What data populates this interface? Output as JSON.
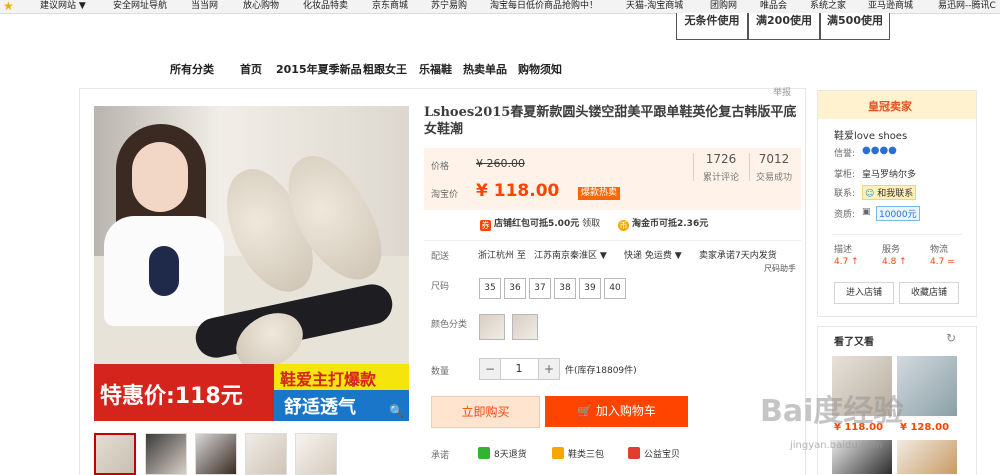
{
  "bookmarks": [
    "建议网站 ▼",
    "安全网址导航",
    "当当网",
    "放心购物",
    "化妆品特卖",
    "京东商城",
    "苏宁易购",
    "淘宝每日低价商品抢购中！",
    "天猫-淘宝商城",
    "团购网",
    "唯品会",
    "系统之家",
    "亚马逊商城",
    "易迅网--腾讯C"
  ],
  "coupons": [
    "无条件使用",
    "满200使用",
    "满500使用"
  ],
  "nav": [
    "所有分类",
    "首页",
    "2015年夏季新品",
    "粗跟女王",
    "乐福鞋",
    "热卖单品",
    "购物须知"
  ],
  "report_label": "举报",
  "product": {
    "title": "Lshoes2015春夏新款圆头镂空甜美平跟单鞋英伦复古韩版平底女鞋潮",
    "price_label": "价格",
    "old_price": "¥ 260.00",
    "taobao_price_label": "淘宝价",
    "price": "¥ 118.00",
    "hot_badge": "爆款热卖",
    "reviews_count": "1726",
    "reviews_label": "累计评论",
    "sales_count": "7012",
    "sales_label": "交易成功",
    "promo_shop": "店铺红包可抵5.00元",
    "promo_shop_action": "领取",
    "promo_coin": "淘金币可抵2.36元",
    "shipping_label": "配送",
    "shipping_from": "浙江杭州 至",
    "shipping_to": "江苏南京秦淮区 ▼",
    "shipping_method": "快递 免运费 ▼",
    "shipping_promise": "卖家承诺7天内发货",
    "size_helper": "尺码助手",
    "size_label": "尺码",
    "sizes": [
      "35",
      "36",
      "37",
      "38",
      "39",
      "40"
    ],
    "color_label": "颜色分类",
    "qty_label": "数量",
    "qty_value": "1",
    "stock": "件(库存18809件)",
    "buy_now": "立即购买",
    "add_cart": "加入购物车",
    "promise_label": "承诺",
    "promises": [
      "8天退货",
      "鞋类三包",
      "公益宝贝"
    ]
  },
  "banner": {
    "deal_text": "特惠价:118元",
    "hot_text": "鞋爱主打爆款",
    "comfort_text": "舒适透气"
  },
  "seller": {
    "badge": "皇冠卖家",
    "shop_name": "鞋爱love shoes",
    "credit_label": "信誉:",
    "keeper_label": "掌柜:",
    "keeper": "皇马罗纳尔多",
    "contact_label": "联系:",
    "contact": "和我联系",
    "cert_label": "资质:",
    "deposit": "10000元",
    "ratings": [
      {
        "label": "描述",
        "value": "4.7 ↑"
      },
      {
        "label": "服务",
        "value": "4.8 ↑"
      },
      {
        "label": "物流",
        "value": "4.7 ="
      }
    ],
    "enter_shop": "进入店铺",
    "fav_shop": "收藏店铺"
  },
  "also_viewed": {
    "title": "看了又看",
    "refresh_icon": "refresh-icon",
    "prices": [
      "¥ 118.00",
      "¥ 128.00"
    ]
  },
  "watermark": {
    "big": "Bai度经验",
    "small": "jingyan.baidu.com"
  }
}
